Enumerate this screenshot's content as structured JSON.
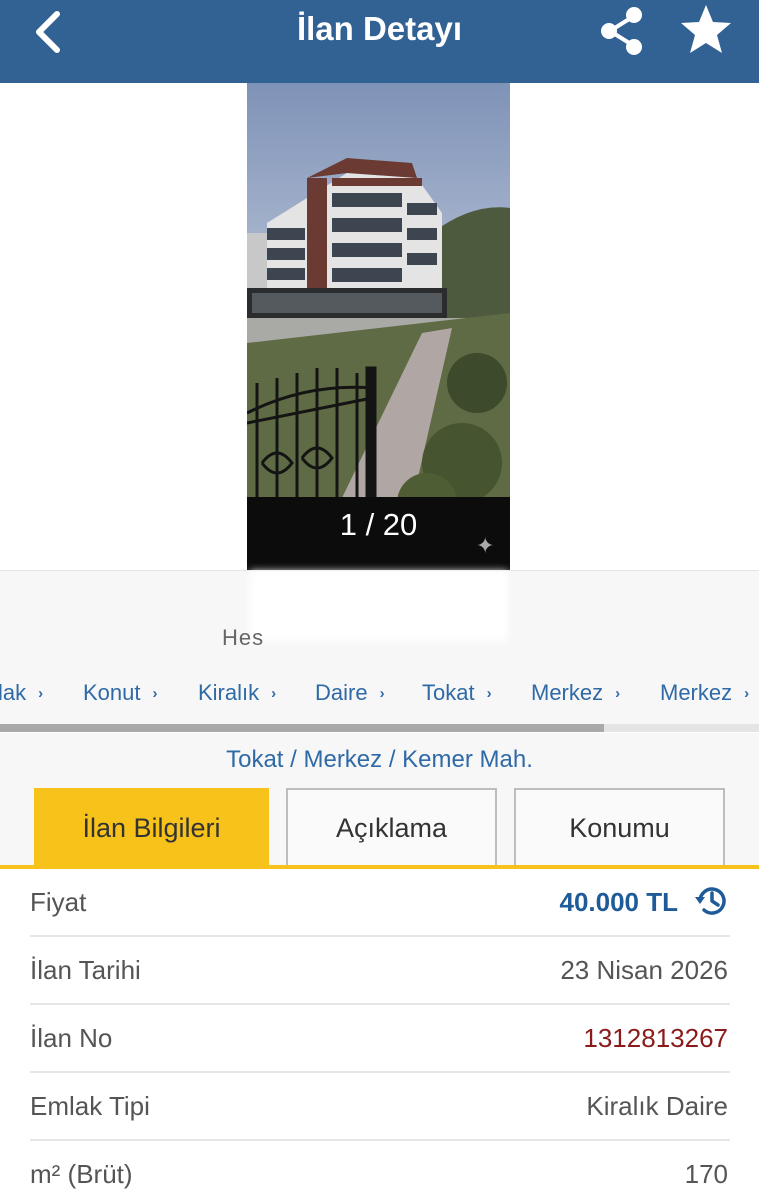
{
  "header": {
    "title": "İlan Detayı",
    "back_icon": "chevron-left-icon",
    "share_icon": "share-icon",
    "favorite_icon": "star-icon",
    "bg_color": "#326193"
  },
  "gallery": {
    "counter": "1 / 20"
  },
  "seller": {
    "text": "Hes"
  },
  "breadcrumb": {
    "items": [
      "lak",
      "Konut",
      "Kiralık",
      "Daire",
      "Tokat",
      "Merkez",
      "Merkez"
    ]
  },
  "location": "Tokat / Merkez / Kemer Mah.",
  "tabs": [
    {
      "label": "İlan Bilgileri",
      "active": true
    },
    {
      "label": "Açıklama",
      "active": false
    },
    {
      "label": "Konumu",
      "active": false
    }
  ],
  "details": [
    {
      "label": "Fiyat",
      "value": "40.000 TL"
    },
    {
      "label": "İlan Tarihi",
      "value": "23 Nisan 2026"
    },
    {
      "label": "İlan No",
      "value": "1312813267"
    },
    {
      "label": "Emlak Tipi",
      "value": "Kiralık Daire"
    },
    {
      "label": "m² (Brüt)",
      "value": "170"
    }
  ],
  "colors": {
    "accent": "#f7c21a",
    "link": "#2f6aa6",
    "price": "#1e5b98",
    "listing_no": "#8b1a1a"
  }
}
